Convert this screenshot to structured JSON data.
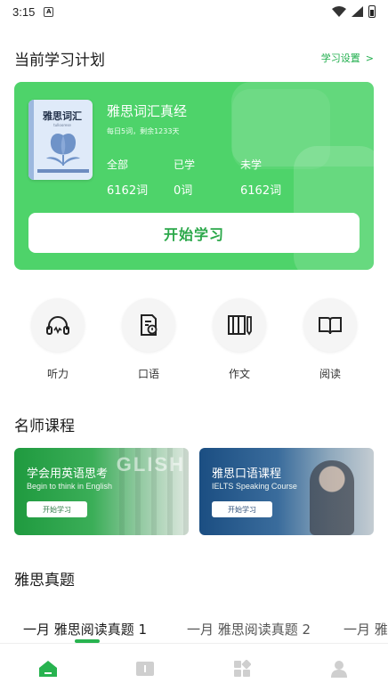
{
  "status_bar": {
    "time": "3:15",
    "notification_glyph": "A"
  },
  "plan": {
    "title": "当前学习计划",
    "settings_label": "学习设置",
    "settings_chevron": ">",
    "book": {
      "cover_title": "雅思词汇",
      "cover_subtitle": "tulloorese",
      "name": "雅思词汇真经",
      "meta": "每日5词，剩余1233天"
    },
    "stats": [
      {
        "label": "全部",
        "value": "6162词"
      },
      {
        "label": "已学",
        "value": "0词"
      },
      {
        "label": "未学",
        "value": "6162词"
      }
    ],
    "start_button": "开始学习"
  },
  "skills": [
    {
      "label": "听力",
      "icon": "headphones-icon"
    },
    {
      "label": "口语",
      "icon": "speaking-doc-icon"
    },
    {
      "label": "作文",
      "icon": "notebook-pen-icon"
    },
    {
      "label": "阅读",
      "icon": "open-book-icon"
    }
  ],
  "courses": {
    "title": "名师课程",
    "items": [
      {
        "title": "学会用英语思考",
        "subtitle": "Begin to think in English",
        "button": "开始学习",
        "bg_text": "GLISH"
      },
      {
        "title": "雅思口语课程",
        "subtitle": "IELTS Speaking Course",
        "button": "开始学习",
        "bg_text": ""
      }
    ]
  },
  "exams": {
    "title": "雅思真题",
    "tabs": [
      "一月 雅思阅读真题 1",
      "一月 雅思阅读真题 2",
      "一月 雅"
    ]
  },
  "bottom_nav": [
    {
      "icon": "home-icon",
      "active": true
    },
    {
      "icon": "book-icon",
      "active": false
    },
    {
      "icon": "grid-icon",
      "active": false
    },
    {
      "icon": "profile-icon",
      "active": false
    }
  ],
  "colors": {
    "accent": "#27b34f",
    "card": "#4ed36a",
    "inactive_icon": "#cfcfcf"
  }
}
